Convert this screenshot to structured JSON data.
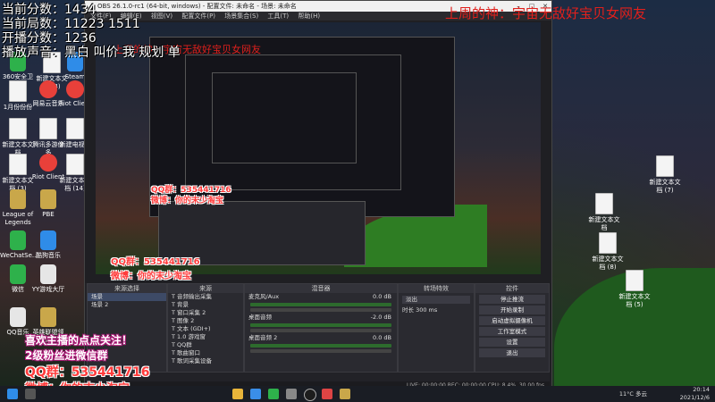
{
  "overlay": {
    "top_lines": [
      "当前分数：1434",
      "当前局数：11223 1511",
      "开播分数：1236",
      "播放声音：黑白 叫价 我 规划 单"
    ],
    "red_banner": "上周的神：宇宙无敌好宝贝女网友",
    "red_banner_small": "上周的神：宇宙无敌好宝贝女网友",
    "follow_text": "喜欢主播的点点关注！",
    "fan_group_text": "2级粉丝进微信群",
    "qq_group": "QQ群：535441716",
    "weibo": "微博：你的末少淘宝",
    "inner_qq": "QQ群：535441716",
    "inner_weibo": "微博：你的末少淘宝"
  },
  "desktop_icons_left": [
    {
      "label": "360安全卫士",
      "style": "grn"
    },
    {
      "label": "新建文本文档 (4)",
      "style": ""
    },
    {
      "label": "Steam",
      "style": "blu"
    },
    {
      "label": "1月份份份",
      "style": ""
    },
    {
      "label": "网易云音乐",
      "style": "red"
    },
    {
      "label": "Riot Client",
      "style": "red"
    },
    {
      "label": "新建文本文档",
      "style": ""
    },
    {
      "label": "腾讯多游份多",
      "style": ""
    },
    {
      "label": "新建电视...",
      "style": ""
    },
    {
      "label": "新建文本文档 (3)",
      "style": ""
    },
    {
      "label": "Riot Client",
      "style": "red"
    },
    {
      "label": "新建文本文档 (14)",
      "style": ""
    },
    {
      "label": "League of Legends",
      "style": "lol"
    },
    {
      "label": "PBE",
      "style": "lol"
    },
    {
      "label": "WeChatSe...",
      "style": "grn"
    },
    {
      "label": "酷狗音乐",
      "style": "blu"
    },
    {
      "label": "微信",
      "style": "grn"
    },
    {
      "label": "YY游戏大厅",
      "style": "mon"
    },
    {
      "label": "QQ音乐",
      "style": "mon"
    },
    {
      "label": "英雄联盟领域",
      "style": "lol"
    }
  ],
  "desktop_icons_right": [
    {
      "label": "新建文本文档 (7)"
    },
    {
      "label": "新建文本文档"
    },
    {
      "label": "新建文本文档 (8)"
    },
    {
      "label": "新建文本文档 (5)"
    }
  ],
  "obs": {
    "title": "OBS 26.1.0-rc1 (64-bit, windows) - 配置文件: 未命名 - 场景: 未命名",
    "menu": [
      "文件(F)",
      "编辑(E)",
      "视图(V)",
      "配置文件(P)",
      "场景集合(S)",
      "工具(T)",
      "帮助(H)"
    ],
    "docks": {
      "scenes": {
        "title": "来源选择",
        "items": [
          "场景",
          "场景 2"
        ]
      },
      "sources": {
        "title": "来源",
        "items": [
          "音频输出采集",
          "背景",
          "窗口采集 2",
          "图像 2",
          "文本 (GDI+)",
          "1.0 游戏窗",
          "QQ群",
          "歌曲窗口",
          "歌词采集设备"
        ]
      },
      "mixer": {
        "title": "混音器",
        "tracks": [
          {
            "name": "麦克风/Aux",
            "db": "0.0 dB"
          },
          {
            "name": "桌面音频",
            "db": "-2.0 dB"
          },
          {
            "name": "桌面音频 2",
            "db": "0.0 dB"
          }
        ]
      },
      "transitions": {
        "title": "转场特效",
        "type": "淡出",
        "duration_label": "时长",
        "duration": "300 ms"
      },
      "controls": {
        "title": "控件",
        "buttons": [
          "停止推流",
          "开始录制",
          "启动虚拟摄像机",
          "工作室模式",
          "设置",
          "退出"
        ]
      }
    },
    "status": "LIVE: 00:00:00   REC: 00:00:00   CPU: 8.4%, 30.00 fps"
  },
  "taskbar": {
    "weather": "11°C 多云",
    "time": "20:14",
    "date": "2021/12/6"
  }
}
